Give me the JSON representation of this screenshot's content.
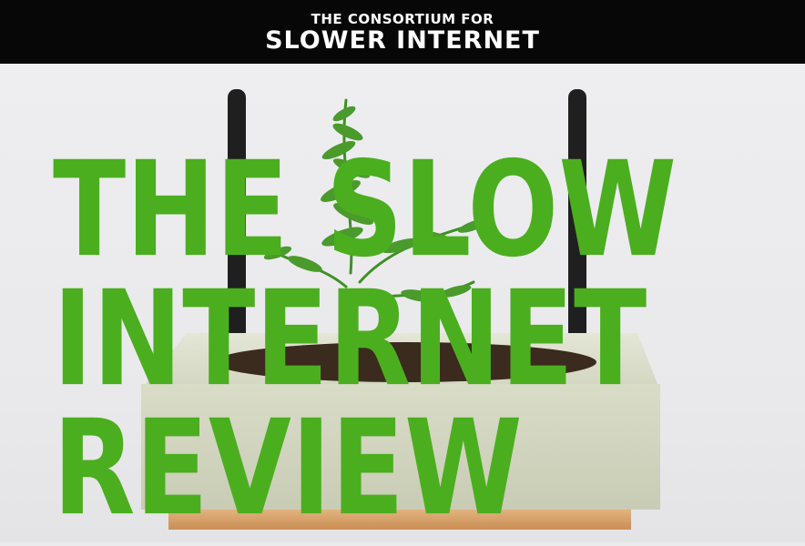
{
  "header": {
    "line1": "THE CONSORTIUM FOR",
    "line2": "SLOWER INTERNET"
  },
  "title": {
    "line1": "THE SLOW",
    "line2": "INTERNET",
    "line3": "REVIEW"
  },
  "image": {
    "subject": "fern-planter-router-icon"
  },
  "colors": {
    "title_green": "#4bae1f",
    "header_bg": "#070707",
    "header_text": "#ffffff"
  }
}
